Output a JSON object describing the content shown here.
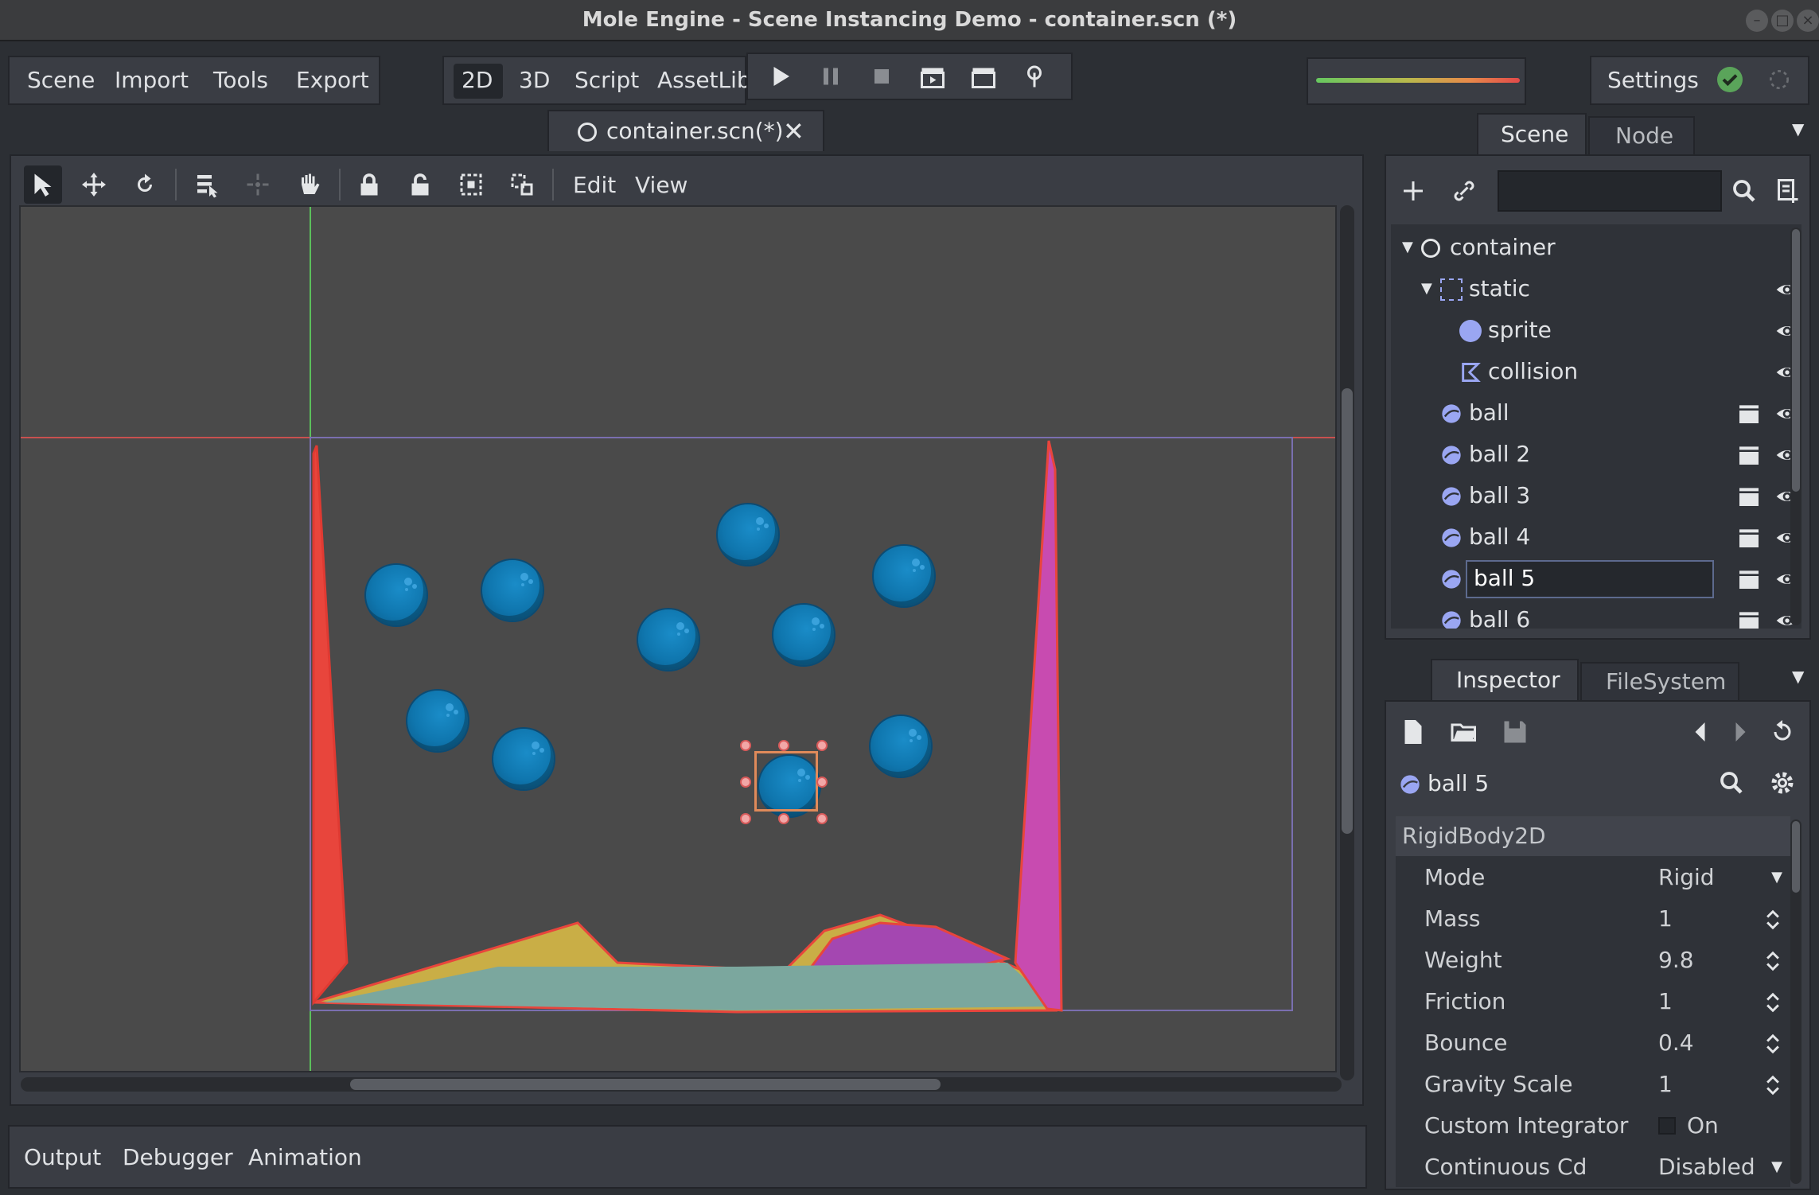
{
  "window": {
    "title": "Mole Engine - Scene Instancing Demo - container.scn (*)"
  },
  "menubar": {
    "items": [
      "Scene",
      "Import",
      "Tools",
      "Export"
    ]
  },
  "workspace_tabs": {
    "items": [
      "2D",
      "3D",
      "Script",
      "AssetLib"
    ],
    "active": "2D"
  },
  "settings": {
    "label": "Settings"
  },
  "editor_tab": {
    "label": "container.scn(*)"
  },
  "canvas_toolbar": {
    "edit_label": "Edit",
    "view_label": "View"
  },
  "scene_dock": {
    "tabs": [
      "Scene",
      "Node"
    ],
    "search_placeholder": "",
    "tree": [
      {
        "label": "container",
        "icon": "node2d-circle-icon",
        "depth": 0,
        "expanded": true
      },
      {
        "label": "static",
        "icon": "static-body-icon",
        "depth": 1,
        "expanded": true,
        "visible": true
      },
      {
        "label": "sprite",
        "icon": "sprite-icon",
        "depth": 2,
        "visible": true
      },
      {
        "label": "collision",
        "icon": "collision-polygon-icon",
        "depth": 2,
        "visible": true
      },
      {
        "label": "ball",
        "icon": "rigidbody-icon",
        "depth": 1,
        "instance": true,
        "visible": true
      },
      {
        "label": "ball 2",
        "icon": "rigidbody-icon",
        "depth": 1,
        "instance": true,
        "visible": true
      },
      {
        "label": "ball 3",
        "icon": "rigidbody-icon",
        "depth": 1,
        "instance": true,
        "visible": true
      },
      {
        "label": "ball 4",
        "icon": "rigidbody-icon",
        "depth": 1,
        "instance": true,
        "visible": true
      },
      {
        "label": "ball 5",
        "icon": "rigidbody-icon",
        "depth": 1,
        "instance": true,
        "visible": true,
        "selected": true
      },
      {
        "label": "ball 6",
        "icon": "rigidbody-icon",
        "depth": 1,
        "instance": true,
        "visible": true
      }
    ]
  },
  "inspector": {
    "tabs": [
      "Inspector",
      "FileSystem"
    ],
    "object_name": "ball 5",
    "section": "RigidBody2D",
    "properties": [
      {
        "key": "Mode",
        "value": "Rigid",
        "control": "dropdown"
      },
      {
        "key": "Mass",
        "value": "1",
        "control": "spinner"
      },
      {
        "key": "Weight",
        "value": "9.8",
        "control": "spinner"
      },
      {
        "key": "Friction",
        "value": "1",
        "control": "spinner"
      },
      {
        "key": "Bounce",
        "value": "0.4",
        "control": "spinner"
      },
      {
        "key": "Gravity Scale",
        "value": "1",
        "control": "spinner"
      },
      {
        "key": "Custom Integrator",
        "value": "On",
        "control": "checkbox"
      },
      {
        "key": "Continuous Cd",
        "value": "Disabled",
        "control": "dropdown"
      }
    ]
  },
  "bottom_panel": {
    "tabs": [
      "Output",
      "Debugger",
      "Animation"
    ]
  },
  "colors": {
    "accent_green": "#6fd36f",
    "accent_red": "#e24a4a",
    "ball_blue": "#0f76ae",
    "wall_left": "#e8453c",
    "wall_right": "#c84bb0",
    "floor_yellow": "#c9ae46",
    "floor_teal": "#7ba79e",
    "floor_purple": "#a447b1"
  }
}
